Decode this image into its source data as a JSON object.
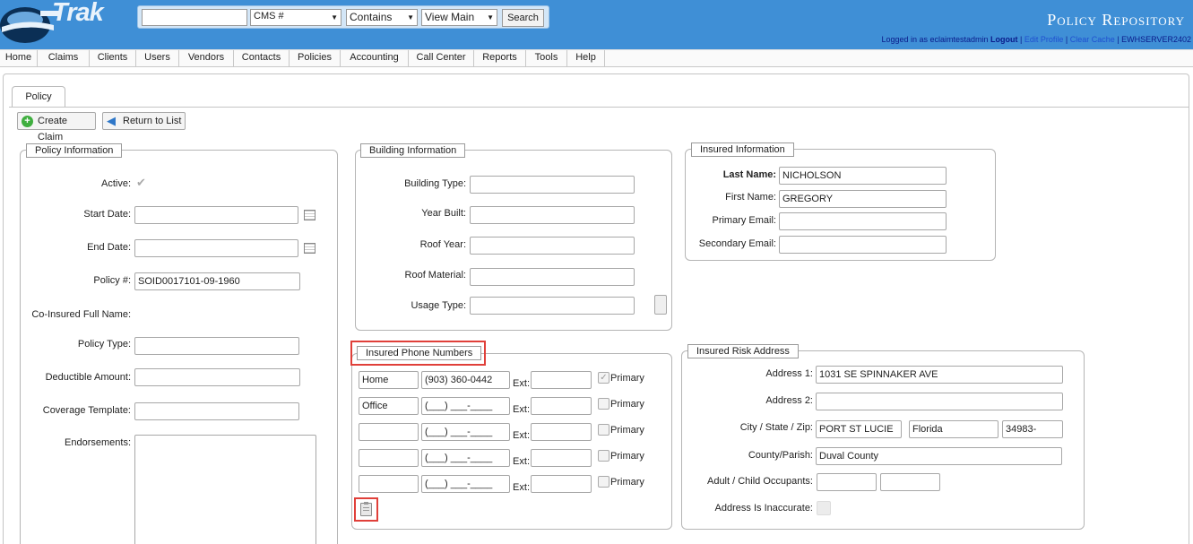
{
  "header": {
    "logo_text": "Trak",
    "app_title": "Policy Repository",
    "search_value": "",
    "search_field": "CMS #",
    "search_operator": "Contains",
    "view": "View Main",
    "search_button": "Search",
    "logged_in_prefix": "Logged in as eclaimtestadmin",
    "logout": "Logout",
    "edit_profile": "Edit Profile",
    "clear_cache": "Clear Cache",
    "server": "EWHSERVER2402"
  },
  "nav": [
    "Home",
    "Claims",
    "Clients",
    "Users",
    "Vendors",
    "Contacts",
    "Policies",
    "Accounting",
    "Call Center",
    "Reports",
    "Tools",
    "Help"
  ],
  "tab": "Policy",
  "toolbar": {
    "create_claim": "Create Claim",
    "return_to_list": "Return to List"
  },
  "policy_info": {
    "legend": "Policy Information",
    "active_label": "Active:",
    "start_date_label": "Start Date:",
    "end_date_label": "End Date:",
    "policy_no_label": "Policy #:",
    "policy_no": "SOID0017101-09-1960",
    "co_insured_label": "Co-Insured Full Name:",
    "policy_type_label": "Policy Type:",
    "deductible_label": "Deductible Amount:",
    "coverage_label": "Coverage Template:",
    "endorsements_label": "Endorsements:"
  },
  "building_info": {
    "legend": "Building Information",
    "building_type_label": "Building Type:",
    "year_built_label": "Year Built:",
    "roof_year_label": "Roof Year:",
    "roof_material_label": "Roof Material:",
    "usage_type_label": "Usage Type:"
  },
  "insured_info": {
    "legend": "Insured Information",
    "last_name_label": "Last Name:",
    "last_name": "NICHOLSON",
    "first_name_label": "First Name:",
    "first_name": "GREGORY",
    "primary_email_label": "Primary Email:",
    "secondary_email_label": "Secondary Email:"
  },
  "phones": {
    "legend": "Insured Phone Numbers",
    "ext_label": "Ext:",
    "primary_label": "Primary",
    "rows": [
      {
        "type": "Home",
        "number": "(903) 360-0442",
        "primary": true
      },
      {
        "type": "Office",
        "number": "(___) ___-____",
        "primary": false
      },
      {
        "type": "",
        "number": "(___) ___-____",
        "primary": false
      },
      {
        "type": "",
        "number": "(___) ___-____",
        "primary": false
      },
      {
        "type": "",
        "number": "(___) ___-____",
        "primary": false
      }
    ]
  },
  "risk_address": {
    "legend": "Insured Risk Address",
    "address1_label": "Address 1:",
    "address1": "1031 SE SPINNAKER AVE",
    "address2_label": "Address 2:",
    "city_label": "City / State / Zip:",
    "city": "PORT ST LUCIE",
    "state": "Florida",
    "zip": "34983-",
    "county_label": "County/Parish:",
    "county": "Duval County",
    "occupants_label": "Adult / Child Occupants:",
    "inaccurate_label": "Address Is Inaccurate:"
  }
}
